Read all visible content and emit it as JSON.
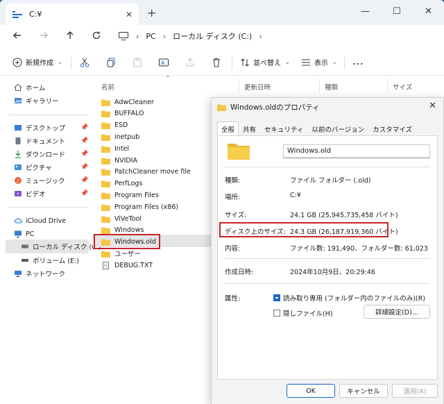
{
  "window": {
    "tab_title": "C:¥",
    "new_tab": "+",
    "minimize": "—",
    "maximize": "☐",
    "close": "✕"
  },
  "address": {
    "crumbs": [
      "PC",
      "ローカル ディスク (C:)"
    ]
  },
  "toolbar": {
    "new_label": "新規作成",
    "sort_label": "並べ替え",
    "view_label": "表示",
    "more": "…"
  },
  "sidebar": {
    "home": "ホーム",
    "gallery": "ギャラリー",
    "desktop": "デスクトップ",
    "documents": "ドキュメント",
    "downloads": "ダウンロード",
    "pictures": "ピクチャ",
    "music": "ミュージック",
    "videos": "ビデオ",
    "icloud": "iCloud Drive",
    "pc": "PC",
    "local_disk": "ローカル ディスク (C:)",
    "volume_e": "ボリューム (E:)",
    "network": "ネットワーク"
  },
  "columns": {
    "name": "名前",
    "modified": "更新日時",
    "type": "種類",
    "size": "サイズ"
  },
  "files": [
    {
      "name": "AdwCleaner"
    },
    {
      "name": "BUFFALO"
    },
    {
      "name": "ESD"
    },
    {
      "name": "inetpub"
    },
    {
      "name": "Intel"
    },
    {
      "name": "NVIDIA"
    },
    {
      "name": "PatchCleaner move file"
    },
    {
      "name": "PerfLogs"
    },
    {
      "name": "Program Files"
    },
    {
      "name": "Program Files (x86)"
    },
    {
      "name": "ViVeTool"
    },
    {
      "name": "Windows"
    },
    {
      "name": "Windows.old"
    },
    {
      "name": "ユーザー"
    },
    {
      "name": "DEBUG.TXT"
    }
  ],
  "dialog": {
    "title": "Windows.oldのプロパティ",
    "close": "✕",
    "tabs": [
      "全般",
      "共有",
      "セキュリティ",
      "以前のバージョン",
      "カスタマイズ"
    ],
    "name": "Windows.old",
    "type_label": "種類:",
    "type_value": "ファイル フォルダー (.old)",
    "location_label": "場所:",
    "location_value": "C:¥",
    "size_label": "サイズ:",
    "size_value": "24.1 GB (25,945,735,458 バイト)",
    "disk_size_label": "ディスク上のサイズ:",
    "disk_size_value": "24.3 GB (26,187,919,360 バイト)",
    "contents_label": "内容:",
    "contents_value": "ファイル数: 191,490、フォルダー数: 61,023",
    "created_label": "作成日時:",
    "created_value": "2024年10月9日、20:29:46",
    "attributes_label": "属性:",
    "readonly_label": "読み取り専用 (フォルダー内のファイルのみ)(R)",
    "hidden_label": "隠しファイル(H)",
    "advanced_button": "詳細設定(D)...",
    "ok": "OK",
    "cancel": "キャンセル",
    "apply": "適用(A)"
  },
  "colors": {
    "accent": "#1a66c9",
    "highlight": "#c8232c",
    "folder": "#f5c542"
  }
}
